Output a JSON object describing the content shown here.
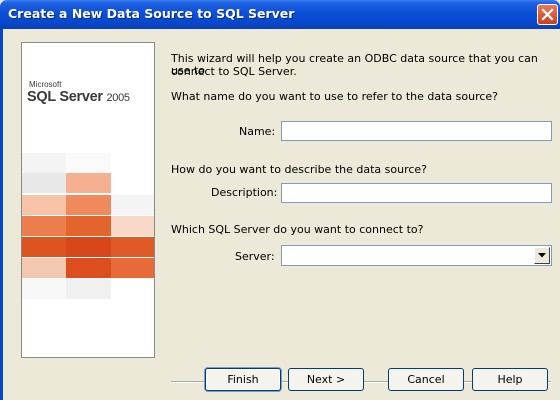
{
  "window": {
    "title": "Create a New Data Source to SQL Server"
  },
  "banner": {
    "vendor": "Microsoft",
    "product": "SQL Server",
    "version": "2005"
  },
  "intro": {
    "line1": "This wizard will help you create an ODBC data source that you can use to",
    "line2": "connect to SQL Server."
  },
  "name_section": {
    "question": "What name do you want to use to refer to the data source?",
    "label": "Name:",
    "value": ""
  },
  "description_section": {
    "question": "How do you want to describe the data source?",
    "label": "Description:",
    "value": ""
  },
  "server_section": {
    "question": "Which SQL Server do you want to connect to?",
    "label": "Server:",
    "value": ""
  },
  "buttons": {
    "finish": "Finish",
    "next": "Next >",
    "cancel": "Cancel",
    "help": "Help"
  },
  "colors": {
    "titlebar": "#0846c8",
    "banner_orange_dark": "#d8461c",
    "banner_orange_light": "#f08050",
    "dialog_bg": "#ece9d8"
  },
  "icons": {
    "close": "close-icon",
    "dropdown": "chevron-down-icon"
  }
}
